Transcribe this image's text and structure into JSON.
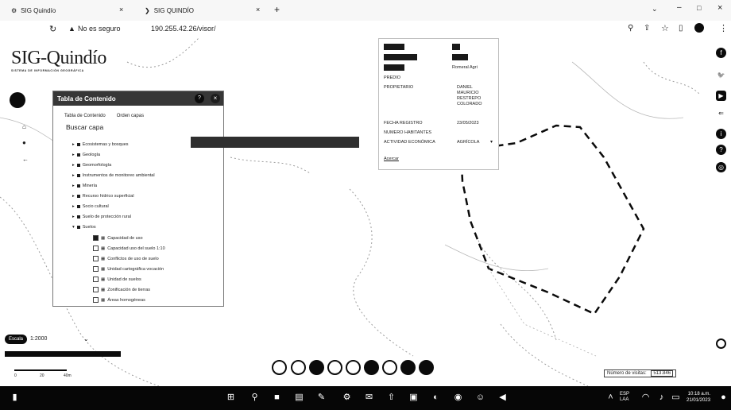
{
  "browser": {
    "tabs": [
      {
        "title": "SIG Quindío"
      },
      {
        "title": "SIG QUINDÍO"
      }
    ],
    "address_warning": "No es seguro",
    "address_url": "190.255.42.26/visor/"
  },
  "app": {
    "logo_text": "SIG-Quindío",
    "logo_tagline": "SISTEMA DE INFORMACIÓN GEOGRÁFICA"
  },
  "toc": {
    "title": "Tabla de Contenido",
    "tabs": [
      "Tabla de Contenido",
      "Orden capas"
    ],
    "search_label": "Buscar capa",
    "groups": [
      {
        "label": "Ecosistemas y bosques"
      },
      {
        "label": "Geología"
      },
      {
        "label": "Geomorfología"
      },
      {
        "label": "Instrumentos de monitoreo ambiental"
      },
      {
        "label": "Minería"
      },
      {
        "label": "Recurso hídrico superficial"
      },
      {
        "label": "Socio cultural"
      },
      {
        "label": "Suelo de protección rural"
      },
      {
        "label": "Suelos"
      }
    ],
    "sublayers": [
      {
        "label": "Capacidad de uso"
      },
      {
        "label": "Capacidad uso del suelo 1:10"
      },
      {
        "label": "Conflictos de uso de suelo"
      },
      {
        "label": "Unidad cartográfica vocación"
      },
      {
        "label": "Unidad de suelos"
      },
      {
        "label": "Zonificación de tierras"
      },
      {
        "label": "Áreas homogéneas"
      }
    ]
  },
  "popup": {
    "rows": [
      {
        "key": "",
        "value": ""
      },
      {
        "key": "",
        "value": ""
      },
      {
        "key": "",
        "value": "Romeral Agri"
      },
      {
        "key": "PREDIO",
        "value": ""
      },
      {
        "key": "PROPIETARIO",
        "value": "DANIEL\nMAURICIO\nRESTREPO\nCOLORADO"
      },
      {
        "key": "FECHA REGISTRO",
        "value": "23/05/2023"
      },
      {
        "key": "NUMERO HABITANTES",
        "value": ""
      },
      {
        "key": "ACTIVIDAD ECONÓMICA",
        "value": "AGRÍCOLA"
      },
      {
        "key": "",
        "value": ""
      },
      {
        "key": "Acercar",
        "value": ""
      }
    ]
  },
  "scale": {
    "label": "Escala",
    "value": "1:2000",
    "bar_labels": [
      "0",
      "20",
      "40m"
    ]
  },
  "visits": {
    "label": "Número de visitas:",
    "count": "513.846"
  },
  "taskbar": {
    "lang": "ESP\nLAA",
    "time": "10:18 a.m.",
    "date": "21/01/2023"
  }
}
